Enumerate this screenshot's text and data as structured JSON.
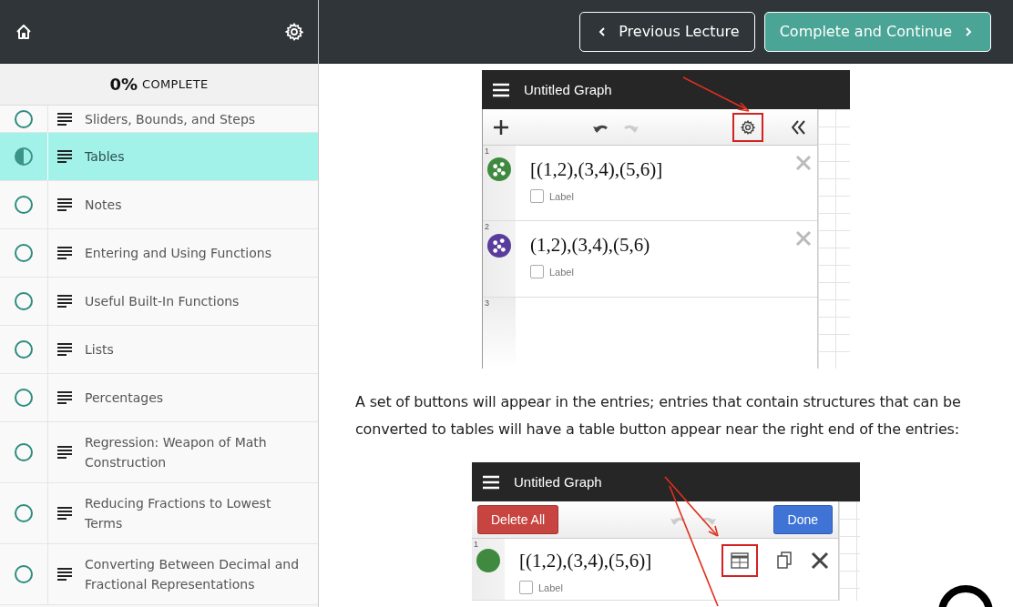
{
  "sidebar": {
    "progress": {
      "percent": "0%",
      "label": "COMPLETE"
    },
    "items": [
      {
        "title": "Sliders, Bounds, and Steps",
        "started": false,
        "selected": false
      },
      {
        "title": "Tables",
        "started": true,
        "selected": true
      },
      {
        "title": "Notes",
        "started": false,
        "selected": false
      },
      {
        "title": "Entering and Using Functions",
        "started": false,
        "selected": false
      },
      {
        "title": "Useful Built-In Functions",
        "started": false,
        "selected": false
      },
      {
        "title": "Lists",
        "started": false,
        "selected": false
      },
      {
        "title": "Percentages",
        "started": false,
        "selected": false
      },
      {
        "title": "Regression: Weapon of Math Construction",
        "started": false,
        "selected": false
      },
      {
        "title": "Reducing Fractions to Lowest Terms",
        "started": false,
        "selected": false
      },
      {
        "title": "Converting Between Decimal and Fractional Representations",
        "started": false,
        "selected": false
      }
    ]
  },
  "header": {
    "previous": "Previous Lecture",
    "next": "Complete and Continue"
  },
  "content": [
    {
      "kind": "graph",
      "title": "Untitled Graph",
      "toolbar": {
        "kind": "default"
      },
      "entries": [
        {
          "number": "1",
          "expression": "[(1,2),(3,4),(5,6)]",
          "kind": "points",
          "color": "#3f8a3f",
          "label": "Label",
          "checked": false
        },
        {
          "number": "2",
          "expression": "(1,2),(3,4),(5,6)",
          "kind": "points",
          "color": "#5a3c9c",
          "label": "Label",
          "checked": false
        },
        {
          "number": "3"
        }
      ]
    },
    {
      "kind": "paragraph",
      "text": "A set of buttons will appear in the entries; entries that contain structures that can be converted to tables will have a table button appear near the right end of the entries:"
    },
    {
      "kind": "graph",
      "title": "Untitled Graph",
      "toolbar": {
        "kind": "edit",
        "delete_button": "Delete All",
        "done_button": "Done"
      },
      "entries": [
        {
          "number": "1",
          "expression": "[(1,2),(3,4),(5,6)]",
          "kind": "solid",
          "color": "#3f8a3f",
          "label": "Label",
          "checked": false
        }
      ]
    }
  ]
}
